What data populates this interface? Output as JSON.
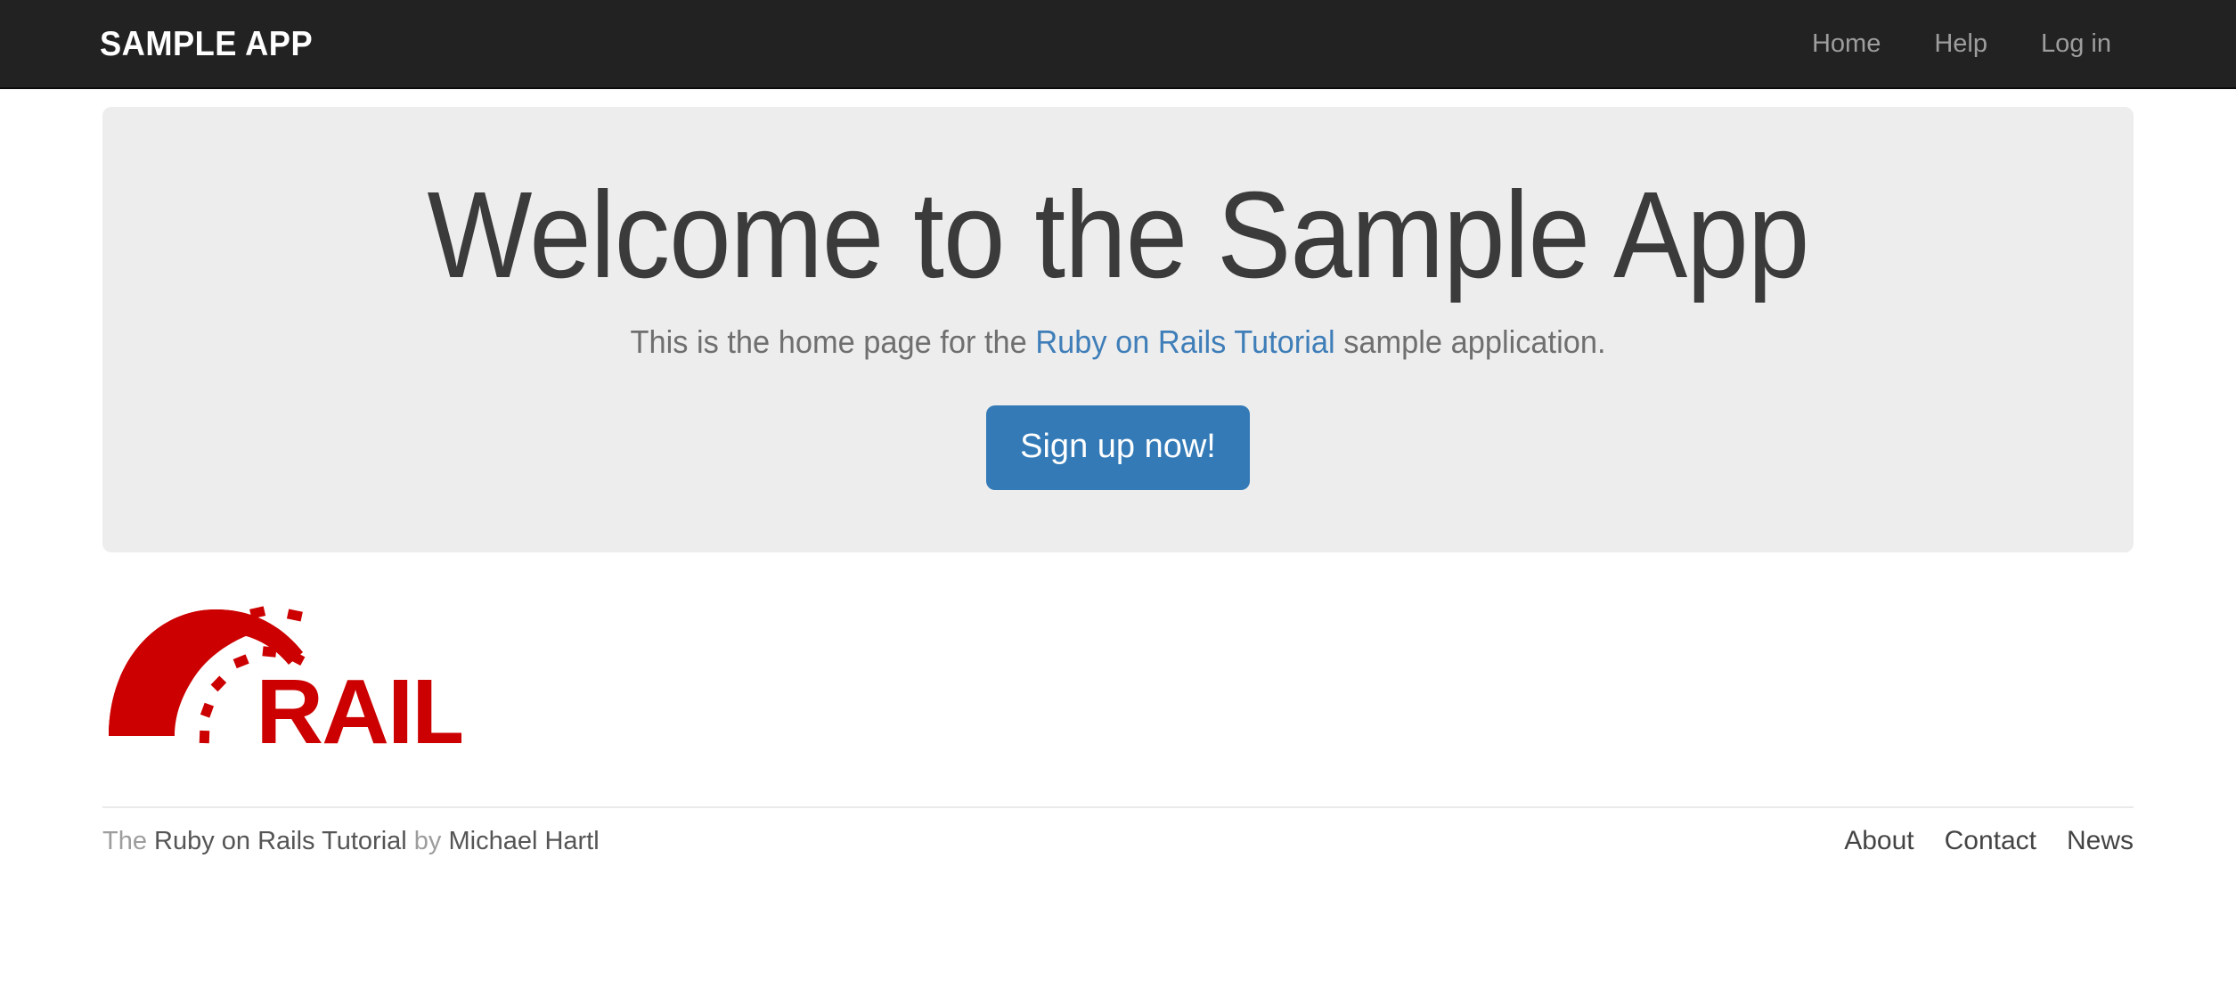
{
  "header": {
    "logo_text": "sample app",
    "nav": [
      {
        "label": "Home",
        "name": "nav-home"
      },
      {
        "label": "Help",
        "name": "nav-help"
      },
      {
        "label": "Log in",
        "name": "nav-login"
      }
    ]
  },
  "jumbotron": {
    "heading": "Welcome to the Sample App",
    "lead_prefix": "This is the home page for the ",
    "lead_link": "Ruby on Rails Tutorial",
    "lead_suffix": " sample application.",
    "cta_label": "Sign up now!"
  },
  "rails_logo": {
    "alt": "Ruby on Rails",
    "wordmark": "RAILS",
    "color": "#cc0000"
  },
  "footer": {
    "credit_prefix": "The ",
    "credit_link_tutorial": "Ruby on Rails Tutorial",
    "credit_middle": " by ",
    "credit_link_author": "Michael Hartl",
    "nav": [
      {
        "label": "About",
        "name": "footer-nav-about"
      },
      {
        "label": "Contact",
        "name": "footer-nav-contact"
      },
      {
        "label": "News",
        "name": "footer-nav-news"
      }
    ]
  },
  "colors": {
    "header_bg": "#222222",
    "jumbotron_bg": "#ededed",
    "accent_blue": "#337ab7",
    "link_blue": "#3f7eb8",
    "rails_red": "#cc0000",
    "heading_gray": "#3b3b3b",
    "muted_gray": "#9d9d9d"
  }
}
